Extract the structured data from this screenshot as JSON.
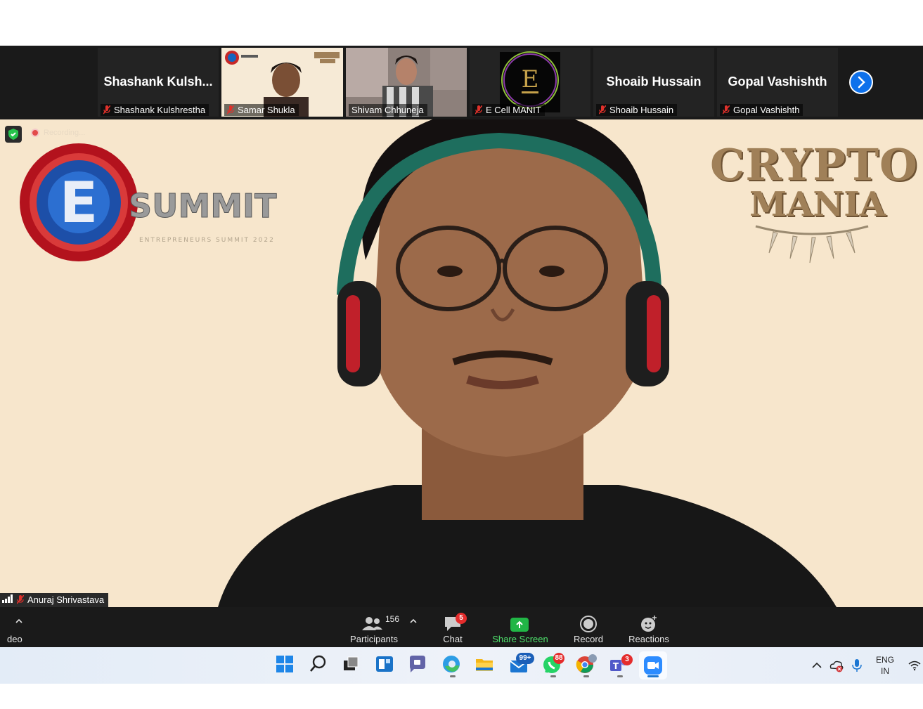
{
  "participants_strip": {
    "tiles": [
      {
        "big_name": "Shashank  Kulsh...",
        "name": "Shashank Kulshrestha",
        "muted": true
      },
      {
        "big_name": "",
        "name": "Samar Shukla",
        "muted": true
      },
      {
        "big_name": "",
        "name": "Shivam Chhuneja",
        "muted": false
      },
      {
        "big_name": "",
        "name": "E Cell MANIT",
        "muted": true
      },
      {
        "big_name": "Shoaib Hussain",
        "name": "Shoaib Hussain",
        "muted": true
      },
      {
        "big_name": "Gopal Vashishth",
        "name": "Gopal Vashishth",
        "muted": true
      }
    ],
    "next_icon": "chevron-right-icon"
  },
  "main_video": {
    "recording_label": "Recording...",
    "logo_left": {
      "letter": "E",
      "word": "SUMMIT",
      "tagline": "ENTREPRENEURS SUMMIT 2022"
    },
    "logo_right": {
      "line1": "CRYPTO",
      "line2": "MANIA"
    },
    "speaker_name": "Anuraj Shrivastava"
  },
  "toolbar": {
    "video_label": "deo",
    "participants_count": "156",
    "participants_label": "Participants",
    "chat_label": "Chat",
    "chat_badge": "5",
    "share_label": "Share Screen",
    "record_label": "Record",
    "reactions_label": "Reactions",
    "share_color": "#4ee26c"
  },
  "taskbar": {
    "mail_badge": "99+",
    "whatsapp_badge": "88",
    "teams_badge": "3",
    "language_line1": "ENG",
    "language_line2": "IN"
  },
  "colors": {
    "strip_bg": "#1a1a1a",
    "main_bg": "#f7e6cc",
    "accent_blue": "#0e71eb",
    "muted_red": "#e0312b"
  }
}
